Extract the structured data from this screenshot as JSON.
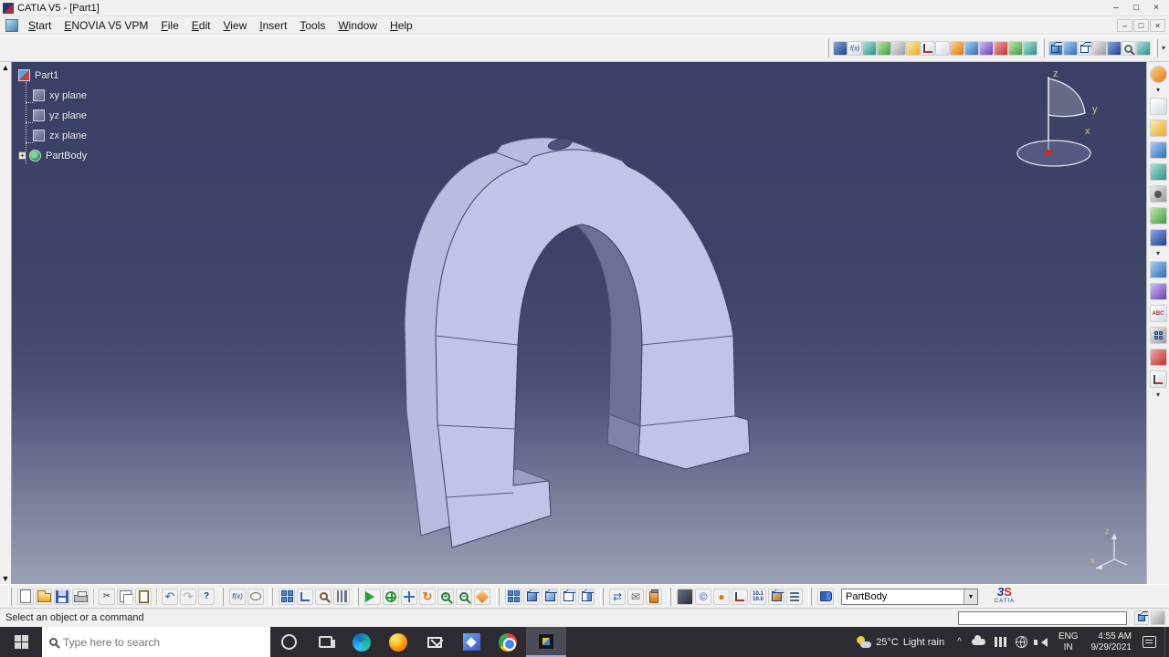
{
  "window": {
    "title": "CATIA V5 - [Part1]",
    "minimize": "–",
    "maximize": "□",
    "close": "×"
  },
  "menu": {
    "items": [
      "Start",
      "ENOVIA V5 VPM",
      "File",
      "Edit",
      "View",
      "Insert",
      "Tools",
      "Window",
      "Help"
    ],
    "mdi_min": "–",
    "mdi_restore": "□",
    "mdi_close": "×"
  },
  "viewport": {
    "scroll_up": "▲",
    "scroll_down": "▼"
  },
  "tree": {
    "root": "Part1",
    "expander": "+",
    "items": [
      {
        "label": "xy plane"
      },
      {
        "label": "yz plane"
      },
      {
        "label": "zx plane"
      },
      {
        "label": "PartBody"
      }
    ]
  },
  "compass": {
    "x": "x",
    "y": "y",
    "z": "z"
  },
  "triad": {
    "z": "z",
    "x": "x"
  },
  "model": {
    "part_color": "#bfc5e7",
    "side_color": "#6b7194",
    "edge_color": "#3c4163"
  },
  "toolbars": {
    "top": [
      "knowledge",
      "formula",
      "rule",
      "check",
      "design-table",
      "catalog",
      "measure-between",
      "measure-item",
      "mass-properties",
      "section",
      "distance-band",
      "clash",
      "draft-analysis",
      "curvature",
      "shading",
      "shading-edges",
      "wireframe",
      "hidden-line",
      "parallel-view",
      "magnifier",
      "depth-effect",
      "overflow"
    ],
    "right": [
      "current-workbench",
      "sketcher",
      "pad",
      "pocket",
      "shaft",
      "hole",
      "rib",
      "stiffener",
      "fillet",
      "chamfer",
      "text",
      "pattern",
      "boolean",
      "axis-system"
    ],
    "bottom": [
      "new",
      "open",
      "save",
      "print",
      "cut",
      "copy",
      "paste",
      "undo",
      "redo",
      "help",
      "formula",
      "comment",
      "design-table",
      "structure",
      "search",
      "list",
      "fly",
      "fit-all",
      "pan",
      "rotate",
      "zoom-in",
      "zoom-out",
      "normal-view",
      "multi-view",
      "iso-view",
      "shaded",
      "wireframe",
      "hide-show",
      "swap-space",
      "mail",
      "material-jar",
      "render",
      "globe",
      "sphere",
      "axis",
      "measure",
      "apply-material",
      "options",
      "catalog"
    ]
  },
  "glyphs": {
    "cut": "✂",
    "undo": "↶",
    "redo": "↷",
    "help": "?",
    "fx": "f(x)",
    "rotate": "↻",
    "swap": "⇄",
    "mail": "✉",
    "globe": "©",
    "abc": "ABC",
    "m1": "10.1",
    "m2": "10.0",
    "plus": "+",
    "minus": "−",
    "combo_arrow": "▾",
    "more": "▾",
    "chevron": "^",
    "sphere": "●"
  },
  "combo": {
    "value": "PartBody"
  },
  "logo": {
    "mark": "3",
    "mark2": "S",
    "text": "CATIA"
  },
  "status": {
    "prompt": "Select an object or a command"
  },
  "taskbar": {
    "search_placeholder": "Type here to search",
    "weather_temp": "25°C",
    "weather_text": "Light rain",
    "lang": "ENG",
    "region": "IN",
    "time": "4:55 AM",
    "date": "9/29/2021"
  }
}
